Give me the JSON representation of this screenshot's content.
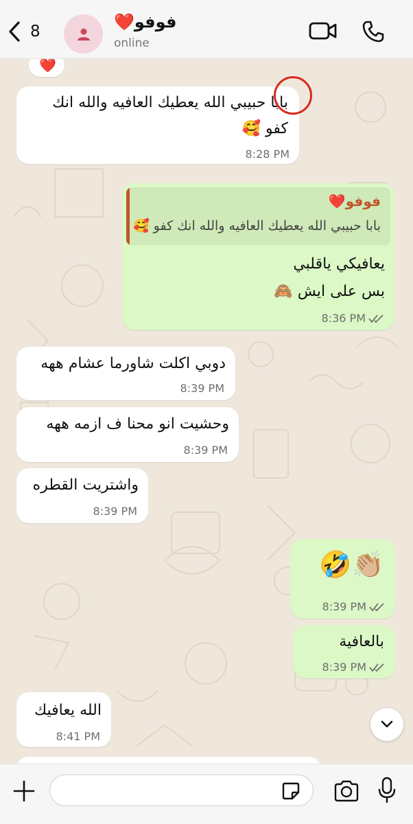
{
  "header": {
    "back_count": "8",
    "contact_name": "فوفو❤️",
    "status": "online"
  },
  "messages": [
    {
      "dir": "in",
      "text": "❤️"
    },
    {
      "dir": "in",
      "line1": "بابا حبيبي الله يعطيك العافيه والله انك",
      "line2": "كفو 🥰",
      "time": "8:28 PM"
    },
    {
      "dir": "out",
      "quote_name": "فوفو❤️",
      "quote_text": "بابا حبيبي الله يعطيك العافيه والله انك كفو 🥰",
      "line1": "يعافيكي ياقلبي",
      "line2": "بس على ايش 🙈",
      "time": "8:36 PM"
    },
    {
      "dir": "in",
      "text": "دوبي اكلت شاورما عشام ههه",
      "time": "8:39 PM"
    },
    {
      "dir": "in",
      "text": "وحشيت انو محنا ف ازمه ههه",
      "time": "8:39 PM"
    },
    {
      "dir": "in",
      "text": "واشتريت القطره",
      "time": "8:39 PM"
    },
    {
      "dir": "out",
      "text": "👏🏼🤣",
      "time": "8:39 PM"
    },
    {
      "dir": "out",
      "text": "بالعافية",
      "time": "8:39 PM"
    },
    {
      "dir": "in",
      "text": "الله يعافيك",
      "time": "8:41 PM"
    }
  ],
  "icons": {
    "back": "chevron-left-icon",
    "video": "video-camera-icon",
    "call": "phone-icon",
    "plus": "plus-icon",
    "sticker": "sticker-icon",
    "camera": "camera-icon",
    "mic": "microphone-icon",
    "scroll": "chevron-down-icon"
  },
  "colors": {
    "incoming_bubble": "#ffffff",
    "outgoing_bubble": "#dbf8c6",
    "quote_accent": "#c0562a",
    "read_ticks": "#6e6e6e",
    "annotation_circle": "#d9281c"
  },
  "input": {
    "value": "",
    "placeholder": ""
  }
}
